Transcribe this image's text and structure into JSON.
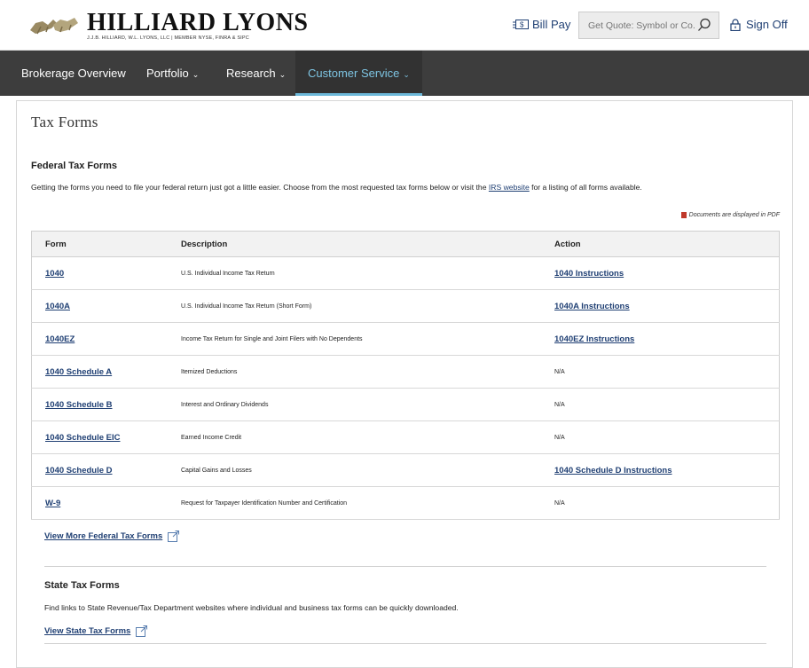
{
  "header": {
    "brand_name": "HILLIARD LYONS",
    "brand_subtitle": "J.J.B. HILLIARD, W.L. LYONS, LLC | MEMBER NYSE, FINRA & SIPC",
    "bill_pay_label": "Bill Pay",
    "quote_placeholder": "Get Quote: Symbol or Co.",
    "sign_off_label": "Sign Off"
  },
  "nav": {
    "items": [
      {
        "label": "Brokerage Overview",
        "has_caret": false
      },
      {
        "label": "Portfolio",
        "has_caret": true
      },
      {
        "label": "Research",
        "has_caret": true
      },
      {
        "label": "Customer Service",
        "has_caret": true,
        "active": true
      }
    ]
  },
  "page": {
    "title": "Tax Forms",
    "federal_heading": "Federal Tax Forms",
    "intro_before": "Getting the forms you need to file your federal return just got a little easier. Choose from the most requested tax forms below or visit the ",
    "intro_link": "IRS website",
    "intro_after": " for a listing of all forms available.",
    "pdf_note": "Documents are displayed in PDF",
    "table": {
      "headers": [
        "Form",
        "Description",
        "Action"
      ],
      "rows": [
        {
          "form": "1040",
          "description": "U.S. Individual Income Tax Return",
          "action": "1040 Instructions",
          "action_link": true
        },
        {
          "form": "1040A",
          "description": "U.S. Individual Income Tax Return (Short Form)",
          "action": "1040A Instructions",
          "action_link": true
        },
        {
          "form": "1040EZ",
          "description": "Income Tax Return for Single and Joint Filers with No Dependents",
          "action": "1040EZ Instructions",
          "action_link": true
        },
        {
          "form": "1040 Schedule A",
          "description": "Itemized Deductions",
          "action": "N/A",
          "action_link": false
        },
        {
          "form": "1040 Schedule B",
          "description": "Interest and Ordinary Dividends",
          "action": "N/A",
          "action_link": false
        },
        {
          "form": "1040 Schedule EIC",
          "description": "Earned Income Credit",
          "action": "N/A",
          "action_link": false
        },
        {
          "form": "1040 Schedule D",
          "description": "Capital Gains and Losses",
          "action": "1040 Schedule D Instructions",
          "action_link": true
        },
        {
          "form": "W-9",
          "description": "Request for Taxpayer Identification Number and Certification",
          "action": "N/A",
          "action_link": false
        }
      ]
    },
    "view_more_federal": "View More Federal Tax Forms",
    "state_heading": "State Tax Forms",
    "state_text": "Find links to State Revenue/Tax Department websites where individual and business tax forms can be quickly downloaded.",
    "view_state": "View State Tax Forms"
  },
  "colors": {
    "link": "#1f3f73",
    "nav_bg": "#3d3d3d",
    "nav_active": "#7ec5e3"
  }
}
